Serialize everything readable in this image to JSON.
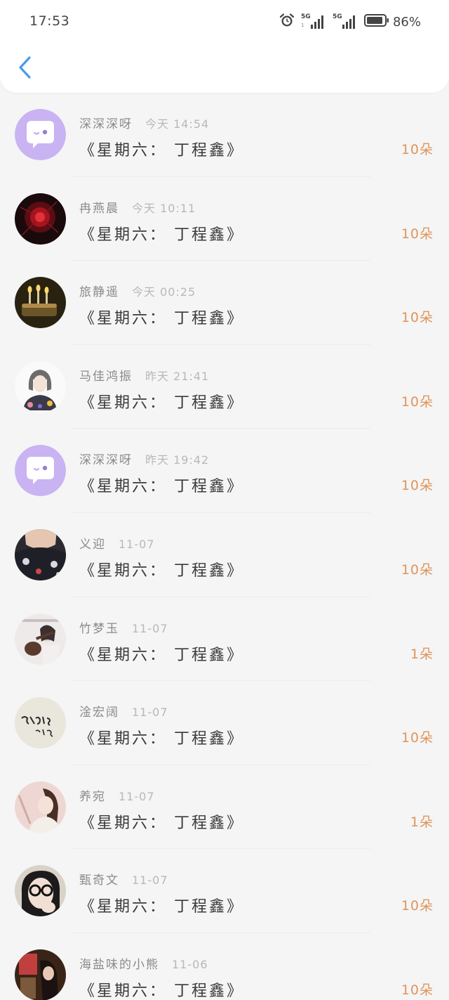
{
  "status_bar": {
    "time": "17:53",
    "signal_1": "5G",
    "signal_1_sub": "1",
    "signal_2": "5G",
    "battery": "86%"
  },
  "header": {
    "back_icon": "chevron-left-icon"
  },
  "colors": {
    "accent": "#4a9be8",
    "count": "#e0955a",
    "bubble": "#c9b3f2"
  },
  "items": [
    {
      "name": "深深深呀",
      "when": "今天 14:54",
      "title": "《星期六： 丁程鑫》",
      "count": "10朵",
      "avatar": "chat-bubble"
    },
    {
      "name": "冉燕晨",
      "when": "今天 10:11",
      "title": "《星期六： 丁程鑫》",
      "count": "10朵",
      "avatar": "red-flower"
    },
    {
      "name": "旅静遥",
      "when": "今天 00:25",
      "title": "《星期六： 丁程鑫》",
      "count": "10朵",
      "avatar": "candles"
    },
    {
      "name": "马佳鸿振",
      "when": "昨天 21:41",
      "title": "《星期六： 丁程鑫》",
      "count": "10朵",
      "avatar": "illustration-girl"
    },
    {
      "name": "深深深呀",
      "when": "昨天 19:42",
      "title": "《星期六： 丁程鑫》",
      "count": "10朵",
      "avatar": "chat-bubble"
    },
    {
      "name": "义迎",
      "when": "11-07",
      "title": "《星期六： 丁程鑫》",
      "count": "10朵",
      "avatar": "floral-dress"
    },
    {
      "name": "竹梦玉",
      "when": "11-07",
      "title": "《星期六： 丁程鑫》",
      "count": "1朵",
      "avatar": "guitar-girl"
    },
    {
      "name": "淦宏阔",
      "when": "11-07",
      "title": "《星期六： 丁程鑫》",
      "count": "10朵",
      "avatar": "calligraphy"
    },
    {
      "name": "养宛",
      "when": "11-07",
      "title": "《星期六： 丁程鑫》",
      "count": "1朵",
      "avatar": "portrait-girl"
    },
    {
      "name": "甄奇文",
      "when": "11-07",
      "title": "《星期六： 丁程鑫》",
      "count": "10朵",
      "avatar": "glasses-girl"
    },
    {
      "name": "海盐味的小熊",
      "when": "11-06",
      "title": "《星期六： 丁程鑫》",
      "count": "10朵",
      "avatar": "window-girl"
    }
  ]
}
